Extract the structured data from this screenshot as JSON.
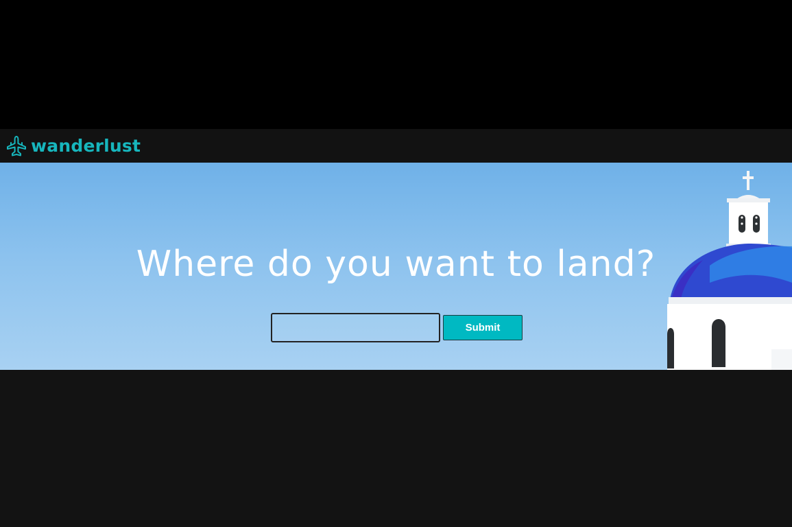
{
  "brand": {
    "name": "wanderlust",
    "icon": "airplane-icon",
    "color": "#17b6bd"
  },
  "hero": {
    "title": "Where do you want to land?",
    "search": {
      "value": "",
      "placeholder": ""
    },
    "submit_label": "Submit",
    "accent_color": "#00b9c2"
  }
}
